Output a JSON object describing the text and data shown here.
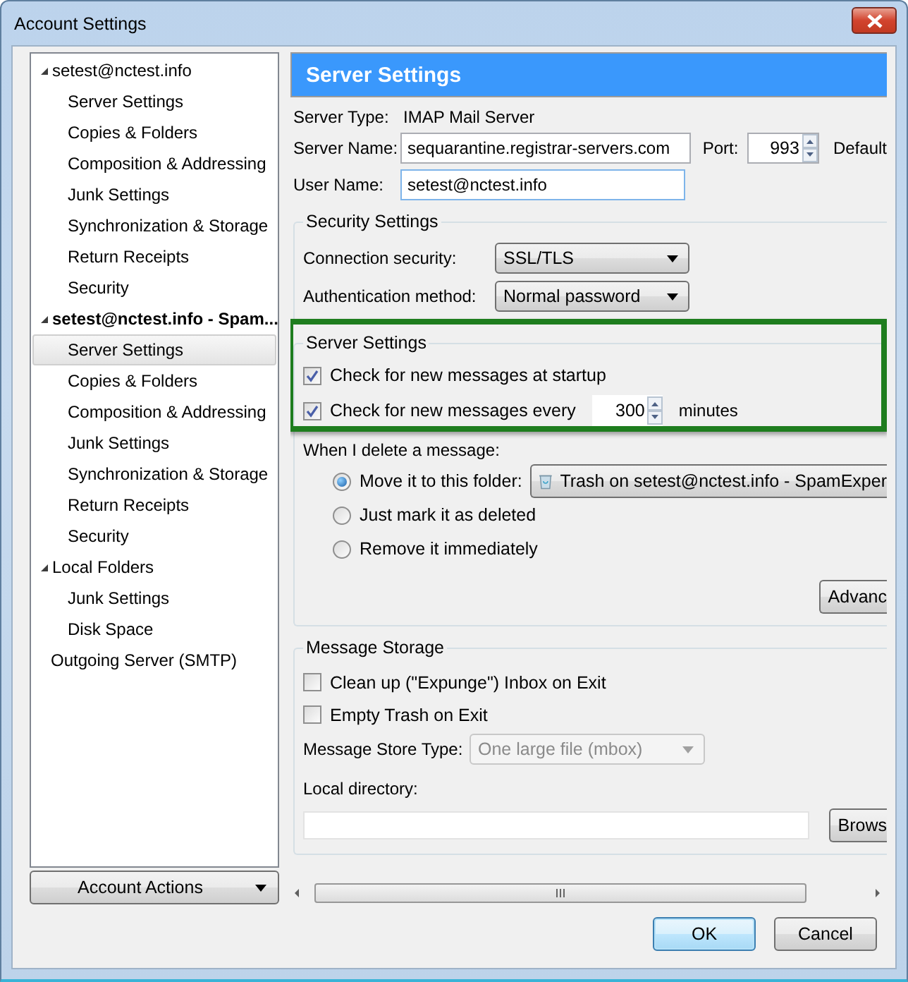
{
  "window": {
    "title": "Account Settings"
  },
  "tree": [
    {
      "label": "setest@nctest.info",
      "expanded": true,
      "current": false,
      "selected": false,
      "children": [
        {
          "label": "Server Settings",
          "selected": false
        },
        {
          "label": "Copies & Folders",
          "selected": false
        },
        {
          "label": "Composition & Addressing",
          "selected": false
        },
        {
          "label": "Junk Settings",
          "selected": false
        },
        {
          "label": "Synchronization & Storage",
          "selected": false
        },
        {
          "label": "Return Receipts",
          "selected": false
        },
        {
          "label": "Security",
          "selected": false
        }
      ]
    },
    {
      "label": "setest@nctest.info - Spam...",
      "expanded": true,
      "current": true,
      "selected": false,
      "children": [
        {
          "label": "Server Settings",
          "selected": true
        },
        {
          "label": "Copies & Folders",
          "selected": false
        },
        {
          "label": "Composition & Addressing",
          "selected": false
        },
        {
          "label": "Junk Settings",
          "selected": false
        },
        {
          "label": "Synchronization & Storage",
          "selected": false
        },
        {
          "label": "Return Receipts",
          "selected": false
        },
        {
          "label": "Security",
          "selected": false
        }
      ]
    },
    {
      "label": "Local Folders",
      "expanded": true,
      "current": false,
      "selected": false,
      "children": [
        {
          "label": "Junk Settings",
          "selected": false
        },
        {
          "label": "Disk Space",
          "selected": false
        }
      ]
    },
    {
      "label": "Outgoing Server (SMTP)",
      "current": false,
      "selected": false
    }
  ],
  "account_actions": "Account Actions",
  "panel": {
    "header": "Server Settings",
    "server_type": {
      "label": "Server Type:",
      "value": "IMAP Mail Server"
    },
    "server_name": {
      "label": "Server Name:",
      "value": "sequarantine.registrar-servers.com"
    },
    "port": {
      "label": "Port:",
      "value": "993",
      "default_label": "Default"
    },
    "user_name": {
      "label": "User Name:",
      "value": "setest@nctest.info"
    },
    "security": {
      "title": "Security Settings",
      "fields": [
        {
          "label": "Connection security:",
          "value": "SSL/TLS"
        },
        {
          "label": "Authentication method:",
          "value": "Normal password"
        }
      ]
    },
    "server_settings": {
      "title": "Server Settings",
      "highlighted": true,
      "checks": [
        {
          "label": "Check for new messages at startup",
          "checked": true
        },
        {
          "label": "Check for new messages every",
          "checked": true,
          "interval": "300",
          "unit": "minutes"
        }
      ],
      "delete_label": "When I delete a message:",
      "delete_options": [
        {
          "label": "Move it to this folder:",
          "selected": true,
          "folder": "Trash on setest@nctest.info - SpamExper"
        },
        {
          "label": "Just mark it as deleted",
          "selected": false
        },
        {
          "label": "Remove it immediately",
          "selected": false
        }
      ],
      "advanced": "Advanc"
    },
    "storage": {
      "title": "Message Storage",
      "checks": [
        {
          "label": "Clean up (\"Expunge\") Inbox on Exit",
          "checked": false
        },
        {
          "label": "Empty Trash on Exit",
          "checked": false
        }
      ],
      "store_type": {
        "label": "Message Store Type:",
        "value": "One large file (mbox)",
        "disabled": true
      },
      "local_dir_label": "Local directory:",
      "browse": "Brows"
    }
  },
  "buttons": [
    {
      "label": "OK",
      "default": true
    },
    {
      "label": "Cancel",
      "default": false
    }
  ]
}
